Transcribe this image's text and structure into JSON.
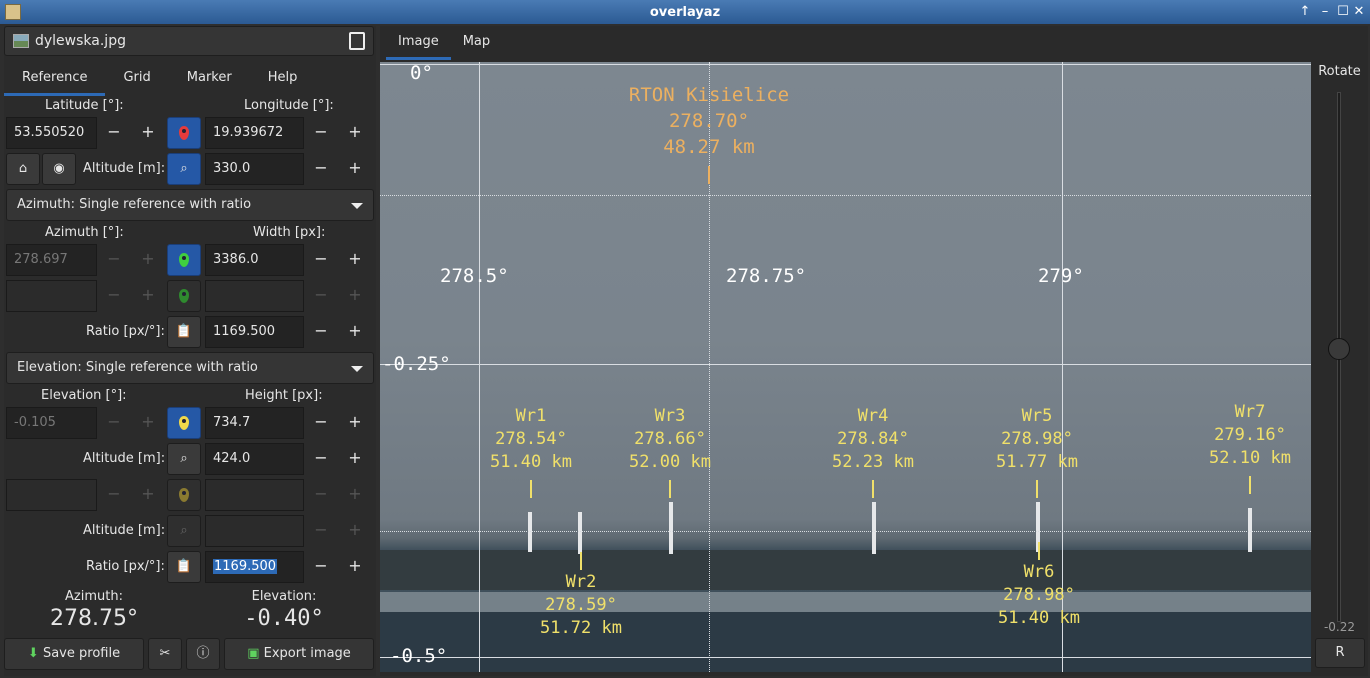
{
  "window": {
    "title": "overlayaz"
  },
  "file": {
    "name": "dylewska.jpg"
  },
  "left_tabs": [
    "Reference",
    "Grid",
    "Marker",
    "Help"
  ],
  "location": {
    "latitude_label": "Latitude [°]:",
    "longitude_label": "Longitude [°]:",
    "latitude": "53.550520",
    "longitude": "19.939672",
    "altitude_label": "Altitude [m]:",
    "altitude": "330.0"
  },
  "azimuth": {
    "mode": "Azimuth: Single reference with ratio",
    "azimuth_label": "Azimuth [°]:",
    "width_label": "Width [px]:",
    "azimuth": "278.697",
    "width": "3386.0",
    "ratio_label": "Ratio [px/°]:",
    "ratio": "1169.500"
  },
  "elevation": {
    "mode": "Elevation: Single reference with ratio",
    "elevation_label": "Elevation [°]:",
    "height_label": "Height [px]:",
    "elevation": "-0.105",
    "height": "734.7",
    "altitude_label": "Altitude [m]:",
    "altitude": "424.0",
    "altitude2_label": "Altitude [m]:",
    "ratio_label": "Ratio [px/°]:",
    "ratio": "1169.500"
  },
  "readout": {
    "azimuth_label": "Azimuth:",
    "azimuth": "278.75°",
    "elevation_label": "Elevation:",
    "elevation": "-0.40°"
  },
  "buttons": {
    "save_profile": "Save profile",
    "export_image": "Export image"
  },
  "right_tabs": [
    "Image",
    "Map"
  ],
  "grid_labels": {
    "el_0": "0°",
    "el_m025": "-0.25°",
    "el_m05": "-0.5°",
    "az_2785": "278.5°",
    "az_27875": "278.75°",
    "az_279": "279°"
  },
  "markers": {
    "rton": {
      "name": "RTON Kisielice",
      "az": "278.70°",
      "dist": "48.27 km"
    },
    "wr1": {
      "name": "Wr1",
      "az": "278.54°",
      "dist": "51.40 km"
    },
    "wr2": {
      "name": "Wr2",
      "az": "278.59°",
      "dist": "51.72 km"
    },
    "wr3": {
      "name": "Wr3",
      "az": "278.66°",
      "dist": "52.00 km"
    },
    "wr4": {
      "name": "Wr4",
      "az": "278.84°",
      "dist": "52.23 km"
    },
    "wr5": {
      "name": "Wr5",
      "az": "278.98°",
      "dist": "51.77 km"
    },
    "wr6": {
      "name": "Wr6",
      "az": "278.98°",
      "dist": "51.40 km"
    },
    "wr7": {
      "name": "Wr7",
      "az": "279.16°",
      "dist": "52.10 km"
    }
  },
  "rotate": {
    "label": "Rotate",
    "value": "-0.22",
    "reset": "R"
  },
  "colors": {
    "accent": "#2d6ab6",
    "marker": "#f0e06a",
    "reference": "#ecb060"
  }
}
